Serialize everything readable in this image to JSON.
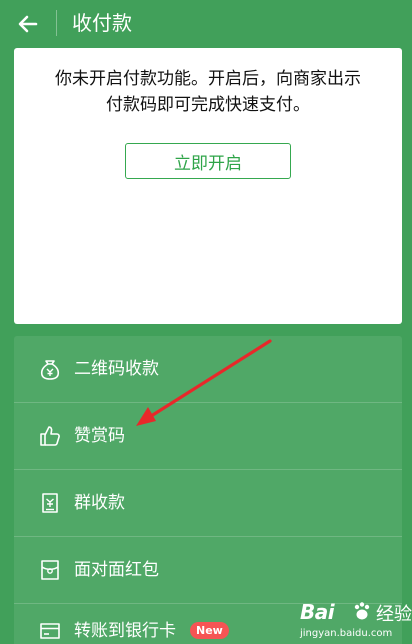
{
  "header": {
    "title": "收付款"
  },
  "card": {
    "message_line1": "你未开启付款功能。开启后，向商家出示",
    "message_line2": "付款码即可完成快速支付。",
    "button_label": "立即开启"
  },
  "menu": {
    "items": [
      {
        "label": "二维码收款",
        "icon": "money-bag-icon"
      },
      {
        "label": "赞赏码",
        "icon": "thumbs-up-icon"
      },
      {
        "label": "群收款",
        "icon": "group-receipt-icon"
      },
      {
        "label": "面对面红包",
        "icon": "red-packet-icon"
      },
      {
        "label": "转账到银行卡",
        "icon": "bank-card-icon",
        "badge": "New"
      }
    ]
  },
  "watermark": {
    "logo": "Bai",
    "suffix": "经验",
    "url": "jingyan.baidu.com"
  },
  "colors": {
    "background": "#41a05a",
    "menu_bg": "#50a867",
    "accent_green": "#2ea448",
    "arrow_red": "#e8282a",
    "badge_red": "#f65454"
  }
}
